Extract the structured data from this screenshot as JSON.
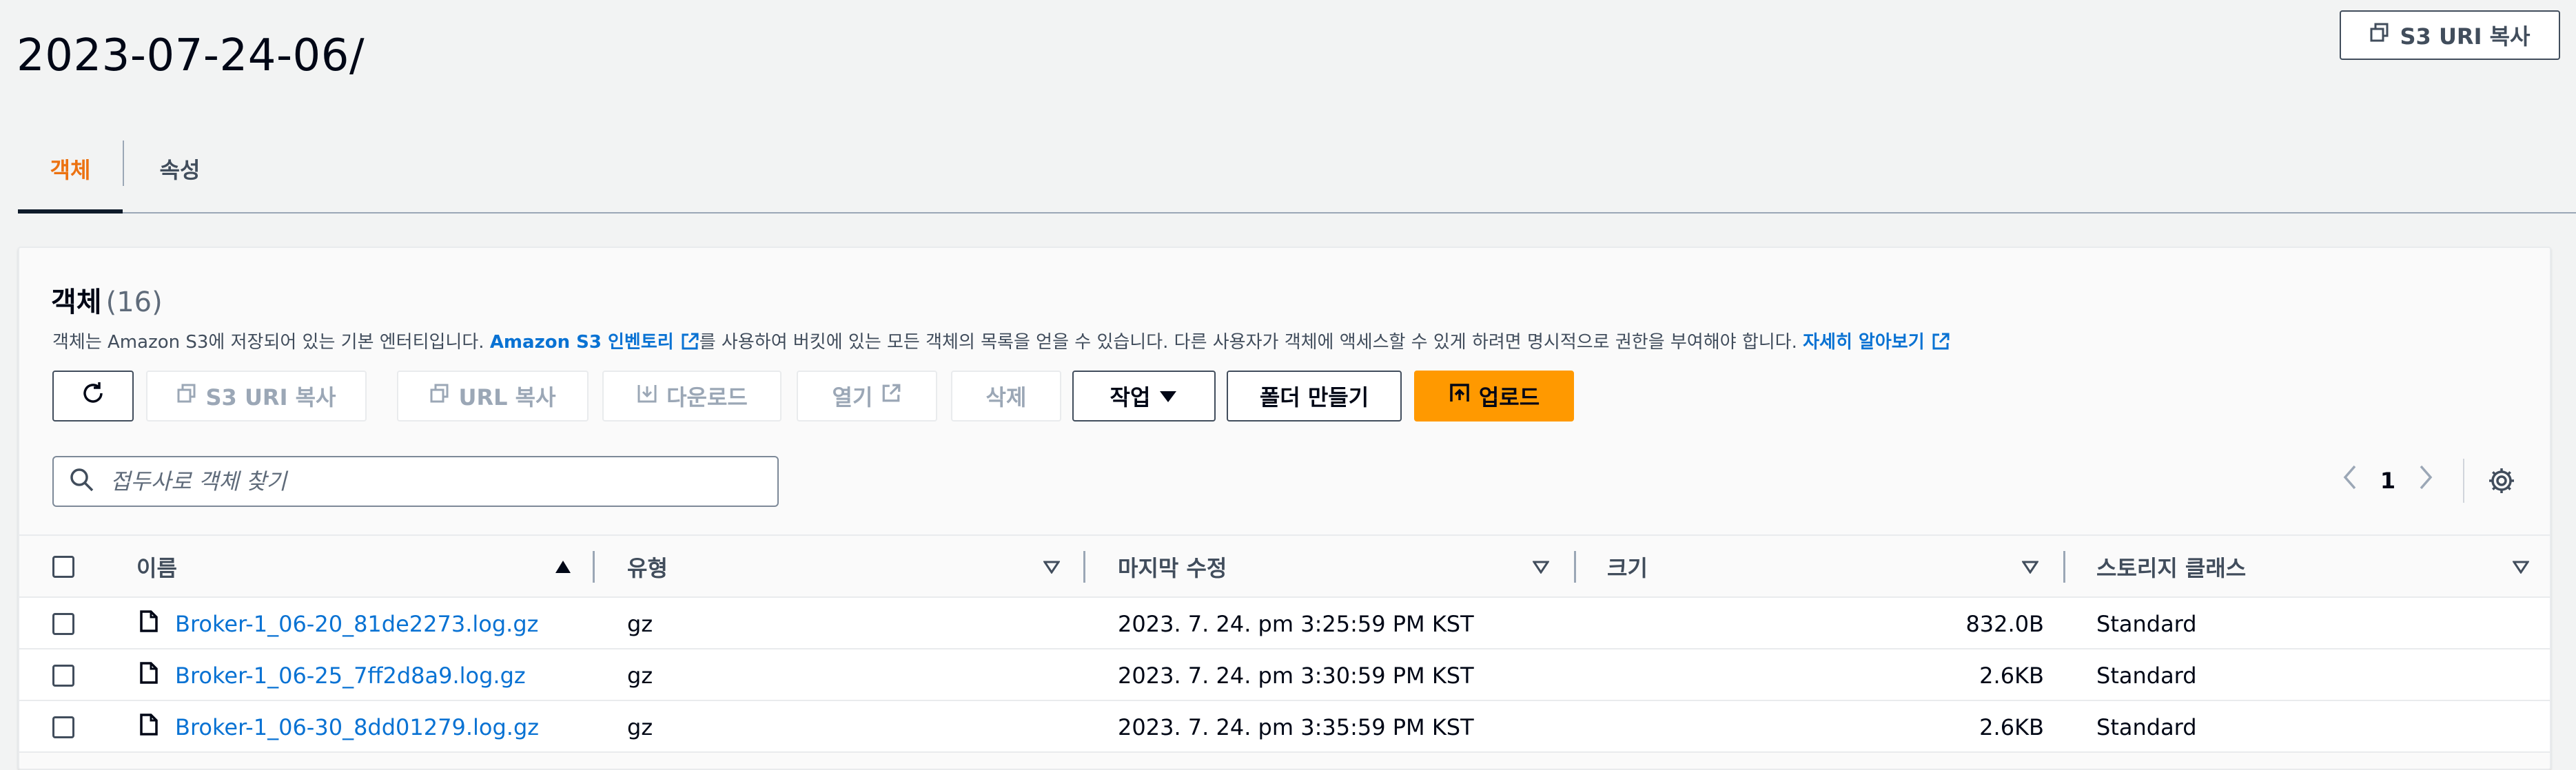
{
  "page": {
    "title": "2023-07-24-06/",
    "copy_s3_uri_label": "S3 URI 복사"
  },
  "tabs": [
    {
      "label": "객체",
      "active": true
    },
    {
      "label": "속성",
      "active": false
    }
  ],
  "objects_panel": {
    "title": "객체",
    "count": "(16)",
    "desc_part1": "객체는 Amazon S3에 저장되어 있는 기본 엔터티입니다. ",
    "desc_link1": "Amazon S3 인벤토리",
    "desc_part2": "를 사용하여 버킷에 있는 모든 객체의 목록을 얻을 수 있습니다. 다른 사용자가 객체에 액세스할 수 있게 하려면 명시적으로 권한을 부여해야 합니다. ",
    "desc_link2": "자세히 알아보기"
  },
  "toolbar": {
    "copy_s3_uri": "S3 URI 복사",
    "copy_url": "URL 복사",
    "download": "다운로드",
    "open": "열기",
    "delete": "삭제",
    "actions": "작업",
    "create_folder": "폴더 만들기",
    "upload": "업로드"
  },
  "search": {
    "placeholder": "접두사로 객체 찾기"
  },
  "pagination": {
    "current_page": "1"
  },
  "table": {
    "columns": [
      "이름",
      "유형",
      "마지막 수정",
      "크기",
      "스토리지 클래스"
    ],
    "rows": [
      {
        "name": "Broker-1_06-20_81de2273.log.gz",
        "type": "gz",
        "modified": "2023. 7. 24. pm 3:25:59 PM KST",
        "size": "832.0B",
        "storage_class": "Standard"
      },
      {
        "name": "Broker-1_06-25_7ff2d8a9.log.gz",
        "type": "gz",
        "modified": "2023. 7. 24. pm 3:30:59 PM KST",
        "size": "2.6KB",
        "storage_class": "Standard"
      },
      {
        "name": "Broker-1_06-30_8dd01279.log.gz",
        "type": "gz",
        "modified": "2023. 7. 24. pm 3:35:59 PM KST",
        "size": "2.6KB",
        "storage_class": "Standard"
      }
    ]
  },
  "colors": {
    "accent_orange": "#ff9900",
    "tab_active": "#ec7211",
    "link_blue": "#0972d3",
    "text_dark": "#000716",
    "disabled_gray": "#9ba7b6"
  },
  "icons": {
    "copy": "copy-icon",
    "refresh": "refresh-icon",
    "download": "download-icon",
    "external": "external-link-icon",
    "caret_down": "caret-down-icon",
    "upload": "upload-icon",
    "search": "search-icon",
    "settings": "gear-icon",
    "file": "file-icon",
    "sort": "sort-icon"
  }
}
